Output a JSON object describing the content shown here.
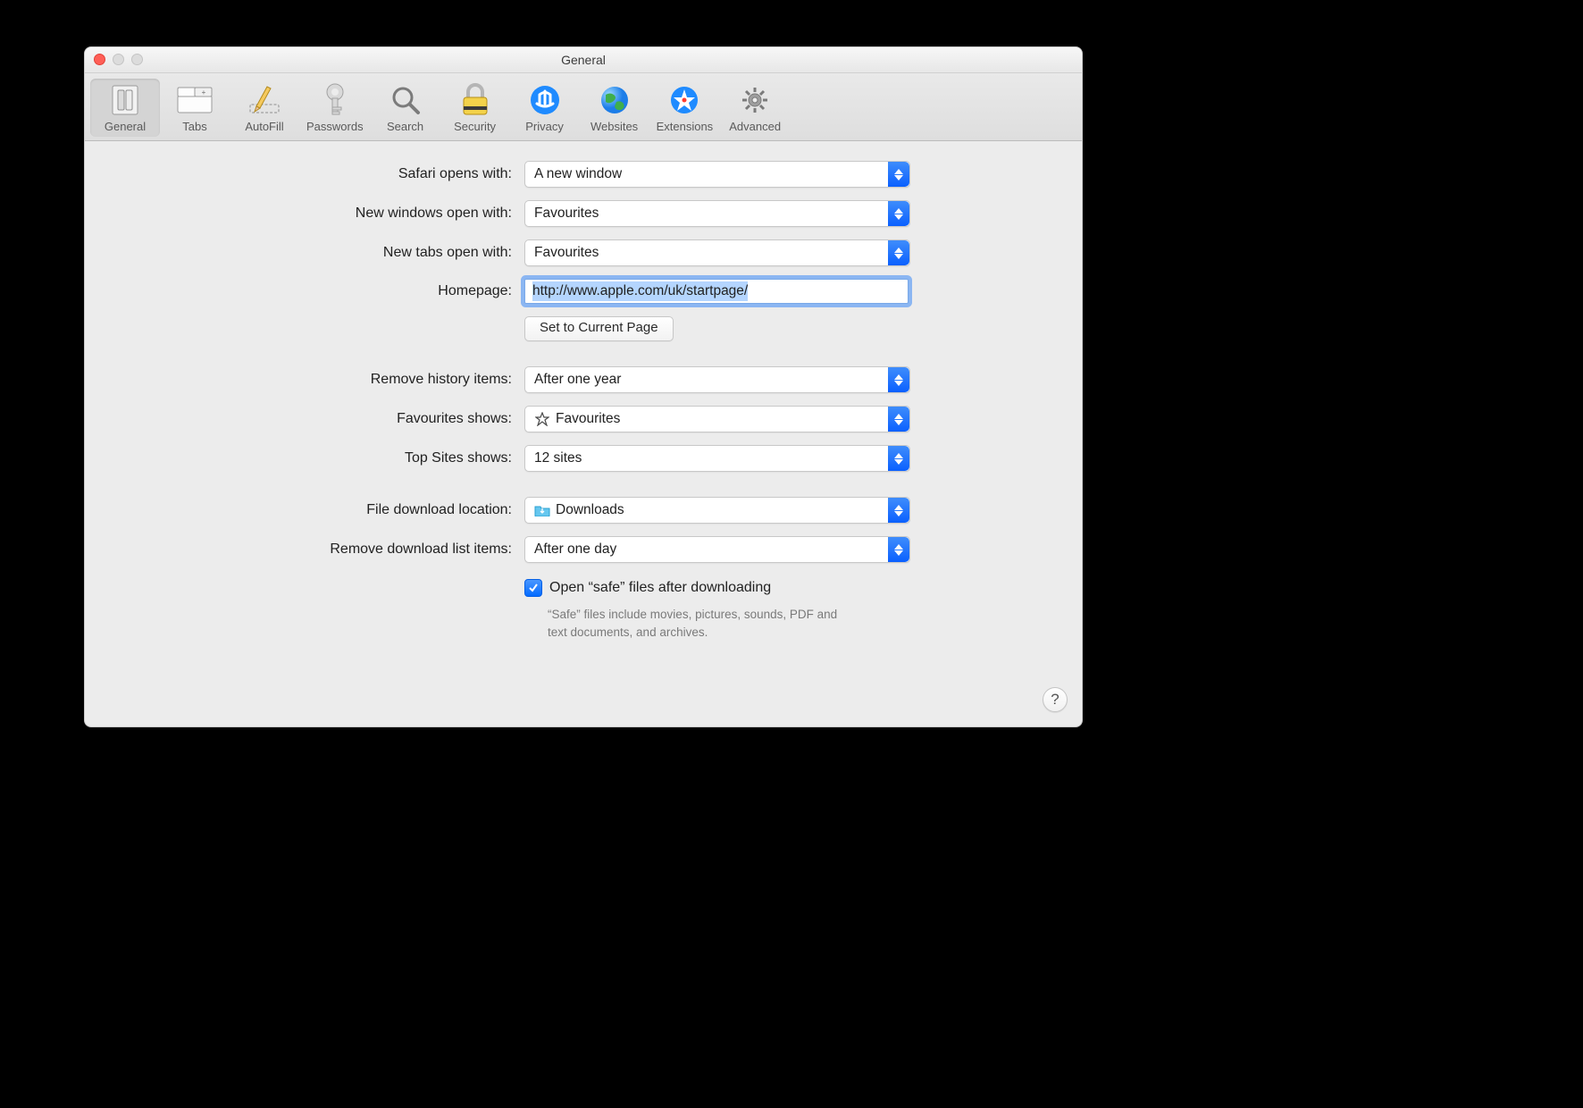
{
  "window": {
    "title": "General"
  },
  "toolbar": {
    "general": "General",
    "tabs": "Tabs",
    "autofill": "AutoFill",
    "passwords": "Passwords",
    "search": "Search",
    "security": "Security",
    "privacy": "Privacy",
    "websites": "Websites",
    "extensions": "Extensions",
    "advanced": "Advanced"
  },
  "labels": {
    "safari_opens_with": "Safari opens with:",
    "new_windows_open_with": "New windows open with:",
    "new_tabs_open_with": "New tabs open with:",
    "homepage": "Homepage:",
    "set_to_current_page": "Set to Current Page",
    "remove_history_items": "Remove history items:",
    "favourites_shows": "Favourites shows:",
    "top_sites_shows": "Top Sites shows:",
    "file_download_location": "File download location:",
    "remove_download_list_items": "Remove download list items:",
    "open_safe_files": "Open “safe” files after downloading",
    "open_safe_files_help": "“Safe” files include movies, pictures, sounds, PDF and text documents, and archives.",
    "help": "?"
  },
  "values": {
    "safari_opens_with": "A new window",
    "new_windows_open_with": "Favourites",
    "new_tabs_open_with": "Favourites",
    "homepage": "http://www.apple.com/uk/startpage/",
    "remove_history_items": "After one year",
    "favourites_shows": "Favourites",
    "top_sites_shows": "12 sites",
    "file_download_location": "Downloads",
    "remove_download_list_items": "After one day",
    "open_safe_files_checked": true
  }
}
